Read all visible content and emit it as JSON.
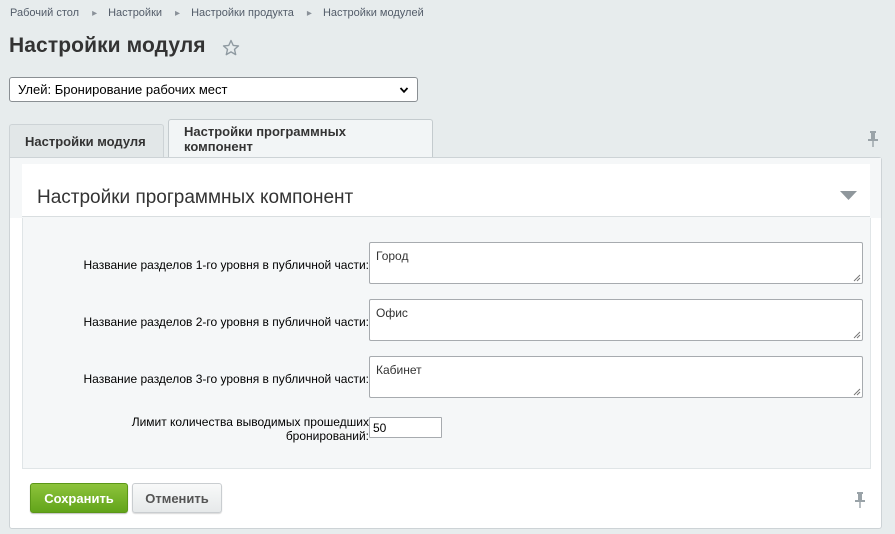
{
  "breadcrumb": [
    "Рабочий стол",
    "Настройки",
    "Настройки продукта",
    "Настройки модулей"
  ],
  "page_title": "Настройки модуля",
  "icons": {
    "star": "star-icon",
    "pin": "pin-icon",
    "collapse": "triangle-down-icon",
    "select_arrow": "chevron-down-icon"
  },
  "module_select": {
    "value": "Улей: Бронирование рабочих мест"
  },
  "tabs": [
    {
      "label": "Настройки модуля",
      "active": false
    },
    {
      "label": "Настройки программных компонент",
      "active": true
    }
  ],
  "section": {
    "title": "Настройки программных компонент"
  },
  "fields": [
    {
      "label": "Название разделов 1-го уровня в публичной части:",
      "value": "Город"
    },
    {
      "label": "Название разделов 2-го уровня в публичной части:",
      "value": "Офис"
    },
    {
      "label": "Название разделов 3-го уровня в публичной части:",
      "value": "Кабинет"
    },
    {
      "label": "Лимит количества выводимых прошедших бронирований:",
      "value": "50"
    }
  ],
  "buttons": {
    "save": "Сохранить",
    "cancel": "Отменить"
  },
  "colors": {
    "save_button": "#6cae22",
    "background": "#e7eced",
    "link": "#535c69"
  }
}
